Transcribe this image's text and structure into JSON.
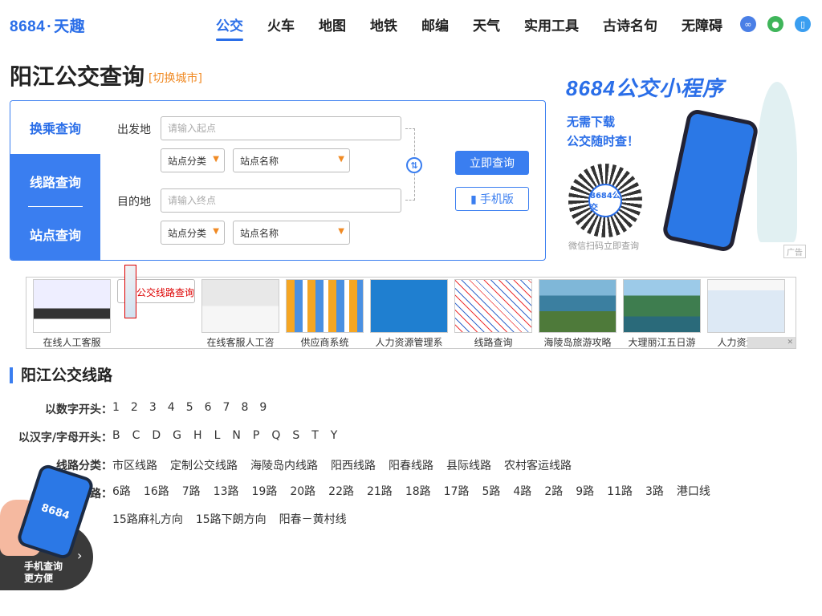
{
  "header": {
    "logo_num": "8684",
    "logo_dot": "·",
    "logo_name": "天趣",
    "nav": [
      "公交",
      "火车",
      "地图",
      "地铁",
      "邮编",
      "天气",
      "实用工具",
      "古诗名句",
      "无障碍"
    ],
    "active_nav": "公交",
    "icons": [
      "mini-program-icon",
      "wechat-icon",
      "mobile-icon"
    ]
  },
  "page": {
    "title": "阳江公交查询",
    "switch_city": "[切换城市]"
  },
  "search": {
    "tabs": [
      "换乘查询",
      "线路查询",
      "站点查询"
    ],
    "from_label": "出发地",
    "from_placeholder": "请输入起点",
    "to_label": "目的地",
    "to_placeholder": "请输入终点",
    "category_select": "站点分类",
    "station_select": "站点名称",
    "query_button": "立即查询",
    "mobile_button": "手机版"
  },
  "ad": {
    "title": "8684公交小程序",
    "sub1": "无需下载",
    "sub2": "公交随时查！",
    "qr_center": "8684公交",
    "qr_caption": "微信扫码立即查询",
    "tag": "广告"
  },
  "strip": {
    "items": [
      "在线人工客服",
      "公交线路查询",
      "在线客服人工咨",
      "供应商系统",
      "人力资源管理系",
      "线路查询",
      "海陵岛旅游攻略",
      "大理丽江五日游",
      "人力资源系统"
    ],
    "selected": "公交线路查询"
  },
  "lines": {
    "section_title": "阳江公交线路",
    "digit_label": "以数字开头：",
    "digits": [
      "1",
      "2",
      "3",
      "4",
      "5",
      "6",
      "7",
      "8",
      "9"
    ],
    "letter_label": "以汉字/字母开头：",
    "letters": [
      "B",
      "C",
      "D",
      "G",
      "H",
      "L",
      "N",
      "P",
      "Q",
      "S",
      "T",
      "Y"
    ],
    "category_label": "线路分类：",
    "categories": [
      "市区线路",
      "定制公交线路",
      "海陵岛内线路",
      "阳西线路",
      "阳春线路",
      "县际线路",
      "农村客运线路"
    ],
    "hot_label": "线路：",
    "hot_lines_1": [
      "6路",
      "16路",
      "7路",
      "13路",
      "19路",
      "20路",
      "22路",
      "21路",
      "18路",
      "17路",
      "5路",
      "4路",
      "2路",
      "9路",
      "11路",
      "3路",
      "港口线",
      "15路麻礼方向"
    ],
    "hot_lines_2": [
      "15路下朗方向",
      "阳春－黄村线"
    ]
  },
  "float": {
    "phone_text": "8684",
    "line1": "手机查询",
    "line2": "更方便"
  },
  "colors": {
    "accent": "#3a7ef0",
    "orange": "#f08a24",
    "selected_red": "#dd0000"
  }
}
